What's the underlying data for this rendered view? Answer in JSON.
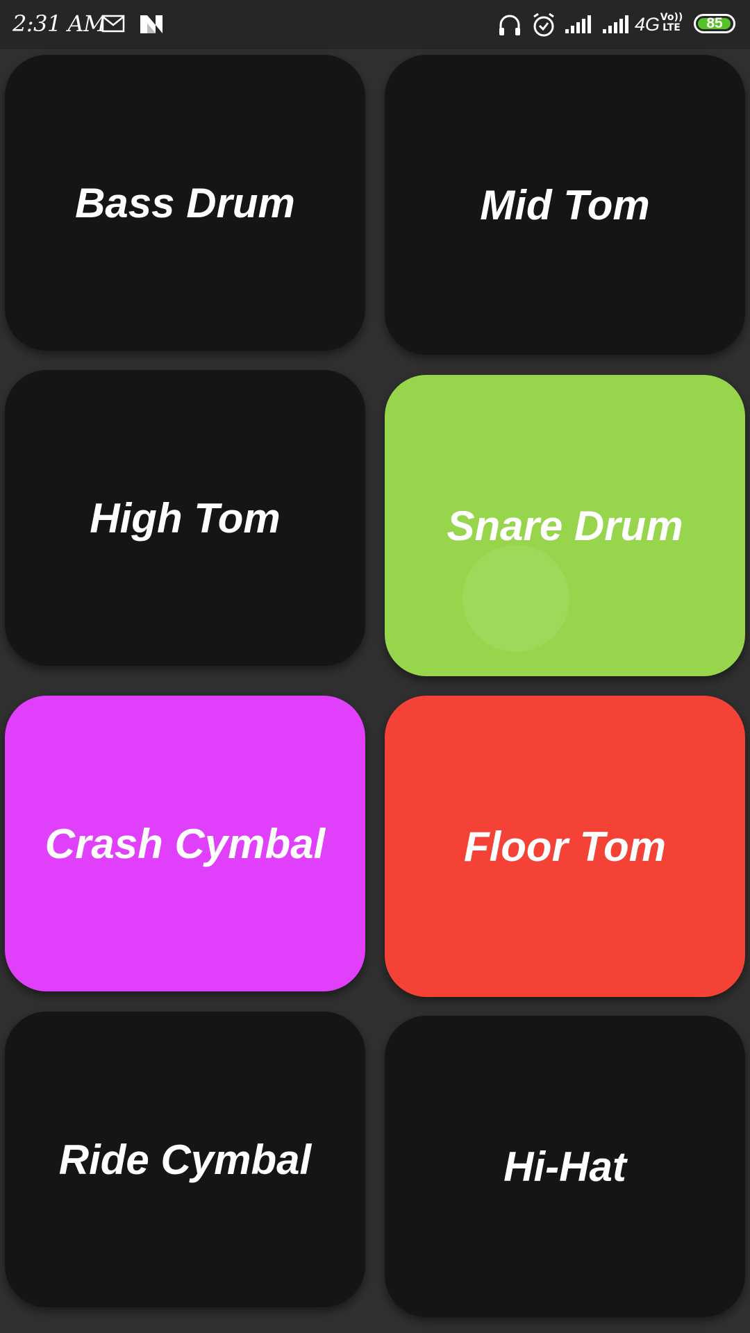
{
  "status_bar": {
    "time": "2:31 AM",
    "network_type": "4G",
    "volte_line1": "Vo))",
    "volte_line2": "LTE",
    "battery_level": "85",
    "battery_color": "#56c22a",
    "left_icons": [
      "mail-icon",
      "notification-app-icon"
    ],
    "right_icons": [
      "headphones-icon",
      "alarm-icon",
      "signal-icon",
      "signal-icon",
      "battery-icon"
    ]
  },
  "pads": [
    {
      "label": "Bass Drum",
      "color": "#151515",
      "active": false
    },
    {
      "label": "Mid Tom",
      "color": "#151515",
      "active": false
    },
    {
      "label": "High Tom",
      "color": "#151515",
      "active": false
    },
    {
      "label": "Snare Drum",
      "color": "#97d64c",
      "active": true
    },
    {
      "label": "Crash Cymbal",
      "color": "#e040fb",
      "active": true
    },
    {
      "label": "Floor Tom",
      "color": "#f44336",
      "active": true
    },
    {
      "label": "Ride Cymbal",
      "color": "#151515",
      "active": false
    },
    {
      "label": "Hi-Hat",
      "color": "#151515",
      "active": false
    }
  ]
}
